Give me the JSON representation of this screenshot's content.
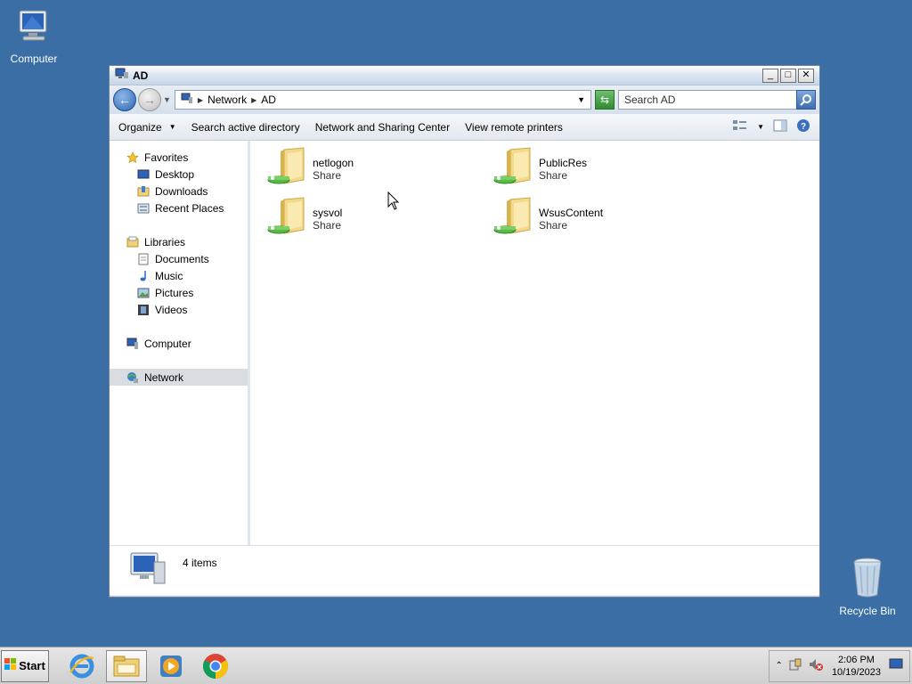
{
  "desktop": {
    "computer_label": "Computer",
    "recycle_label": "Recycle Bin"
  },
  "window": {
    "title": "AD",
    "controls": {
      "minimize": "_",
      "maximize": "□",
      "close": "✕"
    }
  },
  "address": {
    "crumbs": [
      "Network",
      "AD"
    ],
    "search_placeholder": "Search AD"
  },
  "commands": {
    "organize": "Organize",
    "search_ad": "Search active directory",
    "network_sharing": "Network and Sharing Center",
    "view_printers": "View remote printers"
  },
  "nav": {
    "favorites": "Favorites",
    "desktop": "Desktop",
    "downloads": "Downloads",
    "recent": "Recent Places",
    "libraries": "Libraries",
    "documents": "Documents",
    "music": "Music",
    "pictures": "Pictures",
    "videos": "Videos",
    "computer": "Computer",
    "network": "Network"
  },
  "shares": [
    {
      "name": "netlogon",
      "type": "Share"
    },
    {
      "name": "PublicRes",
      "type": "Share"
    },
    {
      "name": "sysvol",
      "type": "Share"
    },
    {
      "name": "WsusContent",
      "type": "Share"
    }
  ],
  "details": {
    "count": "4 items"
  },
  "taskbar": {
    "start_label": "Start",
    "time": "2:06 PM",
    "date": "10/19/2023"
  },
  "colors": {
    "desktop_bg": "#3a6ea5",
    "selected_nav": "#d9dde2"
  },
  "icons": {
    "folder_share": "shared-folder-icon",
    "computer": "computer-icon",
    "recycle": "recycle-bin-icon"
  }
}
